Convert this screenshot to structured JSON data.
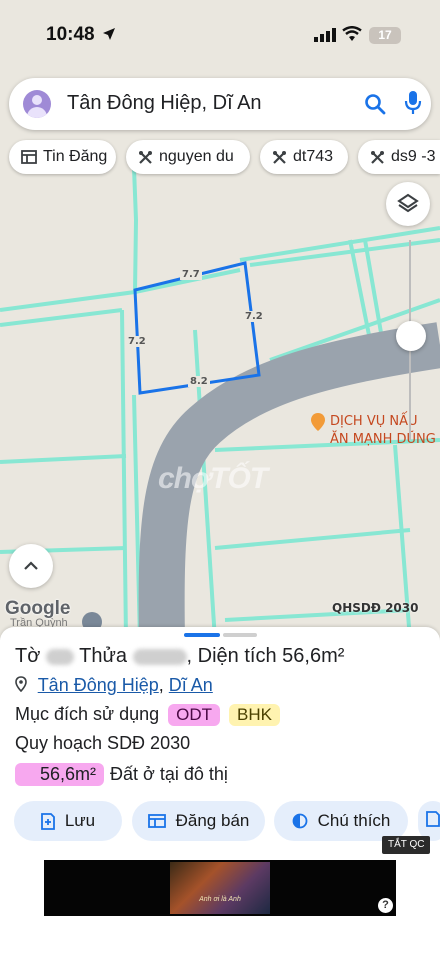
{
  "status_bar": {
    "time": "10:48",
    "battery": "17"
  },
  "search": {
    "query": "Tân Đông Hiệp, Dĩ An"
  },
  "chips": [
    {
      "label": "Tin Đăng",
      "icon": "table-icon"
    },
    {
      "label": "nguyen du",
      "icon": "layer-tool-icon"
    },
    {
      "label": "dt743",
      "icon": "layer-tool-icon"
    },
    {
      "label": "ds9 -3",
      "icon": "layer-tool-icon"
    }
  ],
  "map": {
    "parcel_dimensions": {
      "top": "7.7",
      "right": "7.2",
      "left": "7.2",
      "bottom": "8.2"
    },
    "poi": {
      "line1": "DỊCH VỤ NẤU",
      "line2": "ĂN MẠNH DŨNG"
    },
    "watermark": "chợTỐT",
    "google_logo": "Google",
    "nearby_place": "Trần Quỳnh",
    "layer_badge": "QHSDĐ 2030"
  },
  "sheet": {
    "parcel": {
      "to_label": "Tờ",
      "thua_label": "Thửa",
      "area_label": "Diện tích 56,6m²"
    },
    "address": {
      "ward": "Tân Đông Hiệp",
      "separator": ", ",
      "city": "Dĩ An"
    },
    "purpose": {
      "label": "Mục đích sử dụng",
      "tags": [
        "ODT",
        "BHK"
      ]
    },
    "plan": {
      "label": "Quy hoạch SDĐ 2030"
    },
    "area_row": {
      "value": "56,6m²",
      "description": "Đất ở tại đô thị"
    },
    "actions": [
      {
        "label": "Lưu",
        "icon": "bookmark-add-icon"
      },
      {
        "label": "Đăng bán",
        "icon": "listing-icon"
      },
      {
        "label": "Chú thích",
        "icon": "contrast-icon"
      }
    ],
    "ad_close_label": "TẮT QC",
    "ad": {
      "caption": "Anh ơi là Anh",
      "info": "?"
    }
  },
  "colors": {
    "boundary": "#7ee8d2",
    "road": "#9aa3ad",
    "accent": "#1a73e8",
    "tag_odt": "#f7a8ef",
    "tag_bhk": "#fff3b0"
  }
}
